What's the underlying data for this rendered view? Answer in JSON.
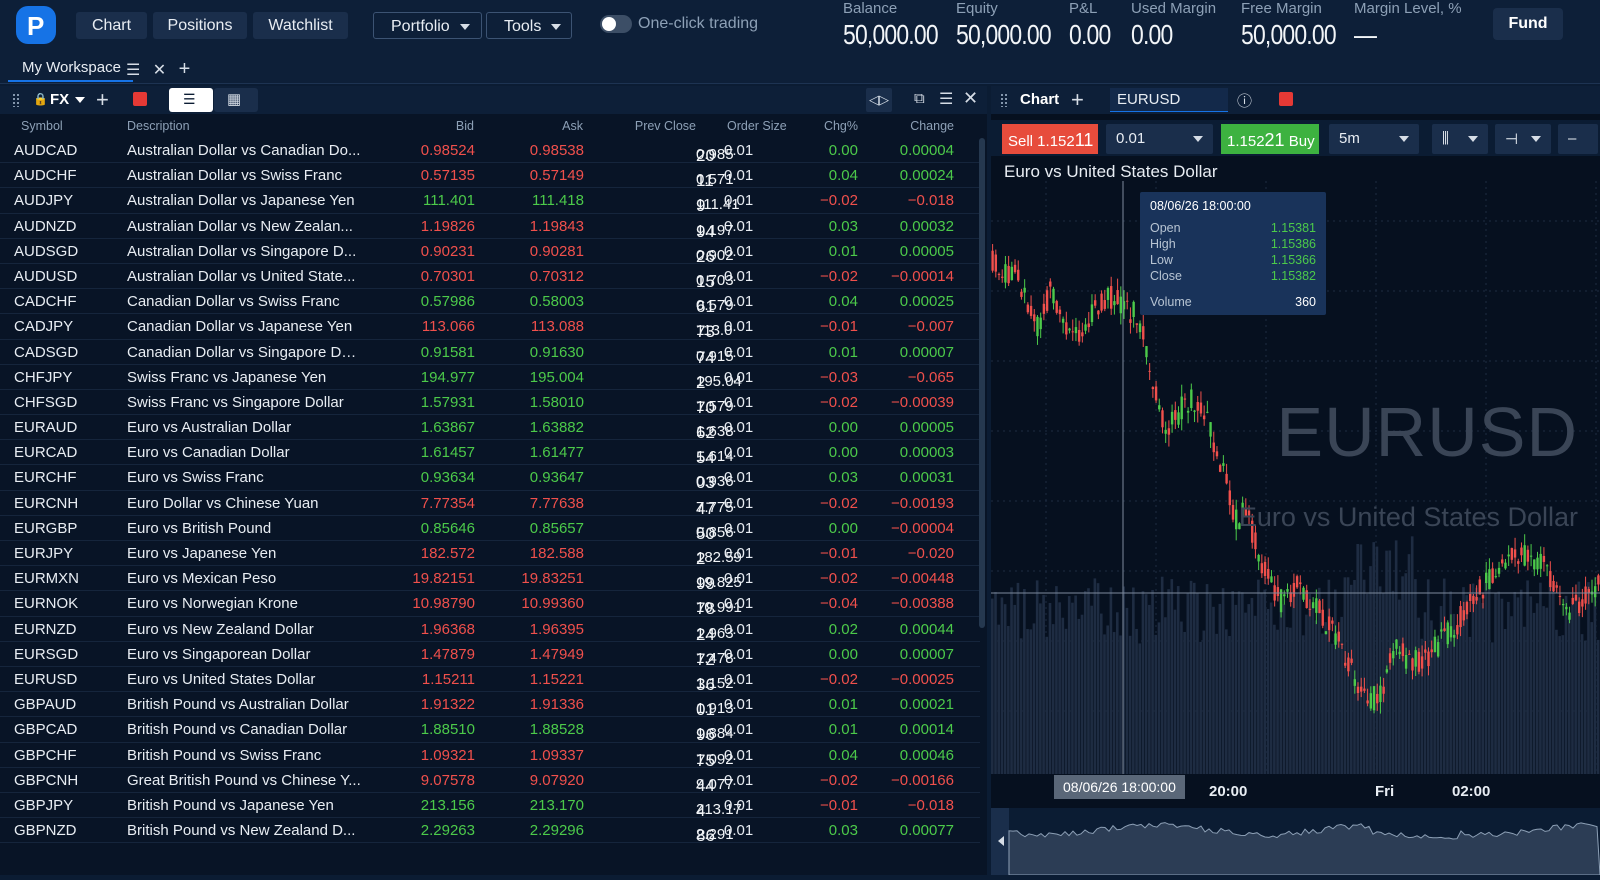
{
  "topbar": {
    "nav": [
      "Chart",
      "Positions",
      "Watchlist"
    ],
    "portfolio": "Portfolio",
    "tools": "Tools",
    "one_click": "One-click trading",
    "stats": [
      {
        "label": "Balance",
        "value": "50,000.00"
      },
      {
        "label": "Equity",
        "value": "50,000.00"
      },
      {
        "label": "P&L",
        "value": "0.00"
      },
      {
        "label": "Used Margin",
        "value": "0.00"
      },
      {
        "label": "Free Margin",
        "value": "50,000.00"
      },
      {
        "label": "Margin Level, %",
        "value": "—"
      }
    ],
    "fund": "Fund"
  },
  "workspace": {
    "tab": "My Workspace"
  },
  "watchlist": {
    "group": "FX",
    "columns": [
      "Symbol",
      "Description",
      "Bid",
      "Ask",
      "Prev Close",
      "Order Size",
      "Chg%",
      "Change"
    ],
    "rows": [
      {
        "sym": "AUDCAD",
        "desc": "Australian Dollar vs Canadian Do...",
        "bid": "0.98524",
        "ask": "0.98538",
        "prev_a": "0.985",
        "prev_b": "20",
        "ord": "0.01",
        "chg": "0.00",
        "change": "0.00004",
        "dir": "up",
        "bd": "dn"
      },
      {
        "sym": "AUDCHF",
        "desc": "Australian Dollar vs Swiss Franc",
        "bid": "0.57135",
        "ask": "0.57149",
        "prev_a": "0.571",
        "prev_b": "11",
        "ord": "0.01",
        "chg": "0.04",
        "change": "0.00024",
        "dir": "up",
        "bd": "dn"
      },
      {
        "sym": "AUDJPY",
        "desc": "Australian Dollar vs Japanese Yen",
        "bid": "111.401",
        "ask": "111.418",
        "prev_a": "111.41",
        "prev_b": "9",
        "ord": "0.01",
        "chg": "−0.02",
        "change": "−0.018",
        "dir": "dn",
        "bd": "up"
      },
      {
        "sym": "AUDNZD",
        "desc": "Australian Dollar vs New Zealan...",
        "bid": "1.19826",
        "ask": "1.19843",
        "prev_a": "1.197",
        "prev_b": "94",
        "ord": "0.01",
        "chg": "0.03",
        "change": "0.00032",
        "dir": "up",
        "bd": "dn"
      },
      {
        "sym": "AUDSGD",
        "desc": "Australian Dollar vs Singapore D...",
        "bid": "0.90231",
        "ask": "0.90281",
        "prev_a": "0.902",
        "prev_b": "26",
        "ord": "0.01",
        "chg": "0.01",
        "change": "0.00005",
        "dir": "up",
        "bd": "dn"
      },
      {
        "sym": "AUDUSD",
        "desc": "Australian Dollar vs United State...",
        "bid": "0.70301",
        "ask": "0.70312",
        "prev_a": "0.703",
        "prev_b": "15",
        "ord": "0.01",
        "chg": "−0.02",
        "change": "−0.00014",
        "dir": "dn",
        "bd": "dn"
      },
      {
        "sym": "CADCHF",
        "desc": "Canadian Dollar vs Swiss Franc",
        "bid": "0.57986",
        "ask": "0.58003",
        "prev_a": "0.579",
        "prev_b": "61",
        "ord": "0.01",
        "chg": "0.04",
        "change": "0.00025",
        "dir": "up",
        "bd": "up"
      },
      {
        "sym": "CADJPY",
        "desc": "Canadian Dollar vs Japanese Yen",
        "bid": "113.066",
        "ask": "113.088",
        "prev_a": "113.0",
        "prev_b": "73",
        "ord": "0.01",
        "chg": "−0.01",
        "change": "−0.007",
        "dir": "dn",
        "bd": "dn"
      },
      {
        "sym": "CADSGD",
        "desc": "Canadian Dollar vs Singapore Do...",
        "bid": "0.91581",
        "ask": "0.91630",
        "prev_a": "0.915",
        "prev_b": "74",
        "ord": "0.01",
        "chg": "0.01",
        "change": "0.00007",
        "dir": "up",
        "bd": "up"
      },
      {
        "sym": "CHFJPY",
        "desc": "Swiss Franc vs Japanese Yen",
        "bid": "194.977",
        "ask": "195.004",
        "prev_a": "195.04",
        "prev_b": "2",
        "ord": "0.01",
        "chg": "−0.03",
        "change": "−0.065",
        "dir": "dn",
        "bd": "up"
      },
      {
        "sym": "CHFSGD",
        "desc": "Swiss Franc vs Singapore Dollar",
        "bid": "1.57931",
        "ask": "1.58010",
        "prev_a": "1.579",
        "prev_b": "70",
        "ord": "0.01",
        "chg": "−0.02",
        "change": "−0.00039",
        "dir": "dn",
        "bd": "up"
      },
      {
        "sym": "EURAUD",
        "desc": "Euro vs Australian Dollar",
        "bid": "1.63867",
        "ask": "1.63882",
        "prev_a": "1.638",
        "prev_b": "62",
        "ord": "0.01",
        "chg": "0.00",
        "change": "0.00005",
        "dir": "up",
        "bd": "up"
      },
      {
        "sym": "EURCAD",
        "desc": "Euro vs Canadian Dollar",
        "bid": "1.61457",
        "ask": "1.61477",
        "prev_a": "1.614",
        "prev_b": "54",
        "ord": "0.01",
        "chg": "0.00",
        "change": "0.00003",
        "dir": "up",
        "bd": "up"
      },
      {
        "sym": "EURCHF",
        "desc": "Euro vs Swiss Franc",
        "bid": "0.93634",
        "ask": "0.93647",
        "prev_a": "0.936",
        "prev_b": "03",
        "ord": "0.01",
        "chg": "0.03",
        "change": "0.00031",
        "dir": "up",
        "bd": "up"
      },
      {
        "sym": "EURCNH",
        "desc": "Euro Dollar vs Chinese Yuan",
        "bid": "7.77354",
        "ask": "7.77638",
        "prev_a": "7.775",
        "prev_b": "47",
        "ord": "0.01",
        "chg": "−0.02",
        "change": "−0.00193",
        "dir": "dn",
        "bd": "dn"
      },
      {
        "sym": "EURGBP",
        "desc": "Euro vs British Pound",
        "bid": "0.85646",
        "ask": "0.85657",
        "prev_a": "0.856",
        "prev_b": "50",
        "ord": "0.01",
        "chg": "0.00",
        "change": "−0.00004",
        "dir": "dn",
        "bd": "up",
        "chgdir": "up"
      },
      {
        "sym": "EURJPY",
        "desc": "Euro vs Japanese Yen",
        "bid": "182.572",
        "ask": "182.588",
        "prev_a": "182.59",
        "prev_b": "2",
        "ord": "0.01",
        "chg": "−0.01",
        "change": "−0.020",
        "dir": "dn",
        "bd": "dn"
      },
      {
        "sym": "EURMXN",
        "desc": "Euro vs Mexican Peso",
        "bid": "19.82151",
        "ask": "19.83251",
        "prev_a": "19.825",
        "prev_b": "99",
        "ord": "0.01",
        "chg": "−0.02",
        "change": "−0.00448",
        "dir": "dn",
        "bd": "dn"
      },
      {
        "sym": "EURNOK",
        "desc": "Euro vs Norwegian Krone",
        "bid": "10.98790",
        "ask": "10.99360",
        "prev_a": "10.991",
        "prev_b": "78",
        "ord": "0.01",
        "chg": "−0.04",
        "change": "−0.00388",
        "dir": "dn",
        "bd": "dn"
      },
      {
        "sym": "EURNZD",
        "desc": "Euro vs New Zealand Dollar",
        "bid": "1.96368",
        "ask": "1.96395",
        "prev_a": "1.963",
        "prev_b": "24",
        "ord": "0.01",
        "chg": "0.02",
        "change": "0.00044",
        "dir": "up",
        "bd": "dn"
      },
      {
        "sym": "EURSGD",
        "desc": "Euro vs Singaporean Dollar",
        "bid": "1.47879",
        "ask": "1.47949",
        "prev_a": "1.478",
        "prev_b": "72",
        "ord": "0.01",
        "chg": "0.00",
        "change": "0.00007",
        "dir": "up",
        "bd": "dn"
      },
      {
        "sym": "EURUSD",
        "desc": "Euro vs United States Dollar",
        "bid": "1.15211",
        "ask": "1.15221",
        "prev_a": "1.152",
        "prev_b": "36",
        "ord": "0.01",
        "chg": "−0.02",
        "change": "−0.00025",
        "dir": "dn",
        "bd": "dn"
      },
      {
        "sym": "GBPAUD",
        "desc": "British Pound vs Australian Dollar",
        "bid": "1.91322",
        "ask": "1.91336",
        "prev_a": "1.913",
        "prev_b": "01",
        "ord": "0.01",
        "chg": "0.01",
        "change": "0.00021",
        "dir": "up",
        "bd": "dn"
      },
      {
        "sym": "GBPCAD",
        "desc": "British Pound vs Canadian Dollar",
        "bid": "1.88510",
        "ask": "1.88528",
        "prev_a": "1.884",
        "prev_b": "96",
        "ord": "0.01",
        "chg": "0.01",
        "change": "0.00014",
        "dir": "up",
        "bd": "up"
      },
      {
        "sym": "GBPCHF",
        "desc": "British Pound vs Swiss Franc",
        "bid": "1.09321",
        "ask": "1.09337",
        "prev_a": "1.092",
        "prev_b": "75",
        "ord": "0.01",
        "chg": "0.04",
        "change": "0.00046",
        "dir": "up",
        "bd": "dn"
      },
      {
        "sym": "GBPCNH",
        "desc": "Great British Pound vs Chinese Y...",
        "bid": "9.07578",
        "ask": "9.07920",
        "prev_a": "9.077",
        "prev_b": "44",
        "ord": "0.01",
        "chg": "−0.02",
        "change": "−0.00166",
        "dir": "dn",
        "bd": "dn"
      },
      {
        "sym": "GBPJPY",
        "desc": "British Pound vs Japanese Yen",
        "bid": "213.156",
        "ask": "213.170",
        "prev_a": "213.17",
        "prev_b": "4",
        "ord": "0.01",
        "chg": "−0.01",
        "change": "−0.018",
        "dir": "dn",
        "bd": "up"
      },
      {
        "sym": "GBPNZD",
        "desc": "British Pound vs New Zealand D...",
        "bid": "2.29263",
        "ask": "2.29296",
        "prev_a": "2.291",
        "prev_b": "86",
        "ord": "0.01",
        "chg": "0.03",
        "change": "0.00077",
        "dir": "up",
        "bd": "up"
      }
    ]
  },
  "chart": {
    "panel_title": "Chart",
    "symbol": "EURUSD",
    "sell_label": "Sell 1.152",
    "sell_big": "11",
    "buy_label": "1.152",
    "buy_big": "21",
    "buy_suffix": " Buy",
    "amount": "0.01",
    "timeframe": "5m",
    "heading": "Euro vs United States Dollar",
    "watermark_symbol": "EURUSD",
    "watermark_name": "Euro vs United States Dollar",
    "tooltip": {
      "date": "08/06/26 18:00:00",
      "open_label": "Open",
      "open": "1.15381",
      "high_label": "High",
      "high": "1.15386",
      "low_label": "Low",
      "low": "1.15366",
      "close_label": "Close",
      "close": "1.15382",
      "volume_label": "Volume",
      "volume": "360"
    },
    "crosshair_time": "08/06/26 18:00:00",
    "xticks": [
      "20:00",
      "Fri",
      "02:00"
    ],
    "colors": {
      "up": "#4cca4a",
      "down": "#f0504c",
      "accent": "#1673e6"
    }
  }
}
